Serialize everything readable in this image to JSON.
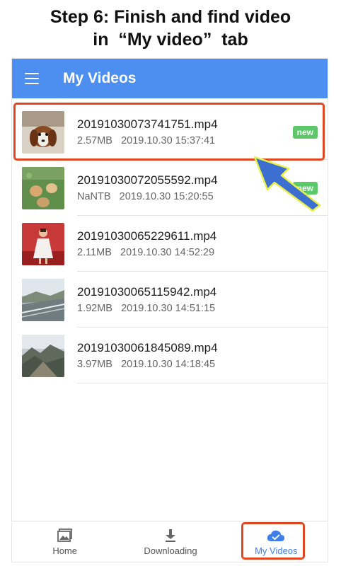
{
  "caption": {
    "line1": "Step 6: Finish and find video",
    "line2": "in  “My video”  tab"
  },
  "app_bar": {
    "title": "My Videos",
    "color": "#4d8ff0"
  },
  "videos": [
    {
      "name": "20191030073741751.mp4",
      "size": "2.57MB",
      "date": "2019.10.30 15:37:41",
      "badge": "new"
    },
    {
      "name": "20191030072055592.mp4",
      "size": "NaNTB",
      "date": "2019.10.30 15:20:55",
      "badge": "new"
    },
    {
      "name": "20191030065229611.mp4",
      "size": "2.11MB",
      "date": "2019.10.30 14:52:29",
      "badge": ""
    },
    {
      "name": "20191030065115942.mp4",
      "size": "1.92MB",
      "date": "2019.10.30 14:51:15",
      "badge": ""
    },
    {
      "name": "20191030061845089.mp4",
      "size": "3.97MB",
      "date": "2019.10.30 14:18:45",
      "badge": ""
    }
  ],
  "nav": {
    "home": "Home",
    "downloading": "Downloading",
    "my_videos": "My Videos"
  },
  "colors": {
    "accent": "#4d8ff0",
    "badge": "#5dc86a",
    "highlight": "#e0461f",
    "arrow": "#3d6fd0"
  }
}
